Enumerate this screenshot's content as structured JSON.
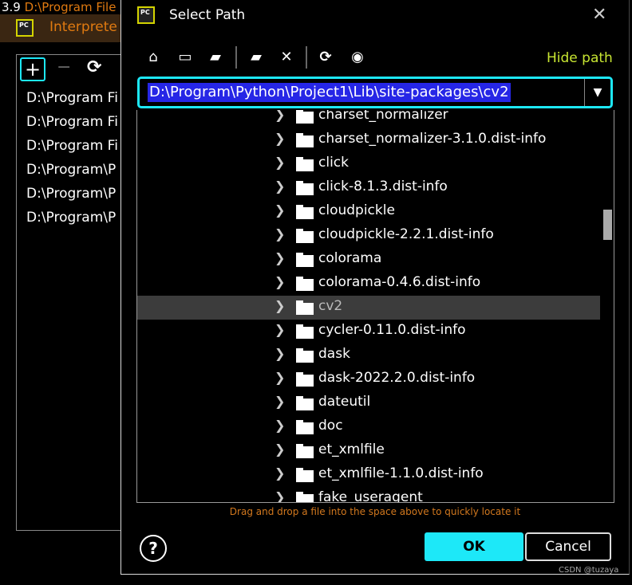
{
  "background": {
    "title_prefix": "3.9",
    "title_path": "D:\\Program File",
    "header_label": "Interprete",
    "toolbar": {
      "add": "+",
      "remove": "−",
      "refresh": "⟳"
    },
    "paths": [
      "D:\\Program Fi",
      "D:\\Program Fi",
      "D:\\Program Fi",
      "D:\\Program\\P",
      "D:\\Program\\P",
      "D:\\Program\\P"
    ]
  },
  "dialog": {
    "title": "Select Path",
    "logo_text": "PC",
    "hide_path": "Hide path",
    "path_value": "D:\\Program\\Python\\Project1\\Lib\\site-packages\\cv2",
    "tree_items": [
      "charset_normalizer",
      "charset_normalizer-3.1.0.dist-info",
      "click",
      "click-8.1.3.dist-info",
      "cloudpickle",
      "cloudpickle-2.2.1.dist-info",
      "colorama",
      "colorama-0.4.6.dist-info",
      "cv2",
      "cycler-0.11.0.dist-info",
      "dask",
      "dask-2022.2.0.dist-info",
      "dateutil",
      "doc",
      "et_xmlfile",
      "et_xmlfile-1.1.0.dist-info",
      "fake_useragent"
    ],
    "selected_item": "cv2",
    "hint": "Drag and drop a file into the space above to quickly locate it",
    "help": "?",
    "ok": "OK",
    "cancel": "Cancel"
  },
  "watermark": "CSDN @tuzaya",
  "colors": {
    "accent": "#1de8f8",
    "hint": "#d2781e",
    "hide_path": "#c8e632",
    "selection": "#2626e6"
  }
}
